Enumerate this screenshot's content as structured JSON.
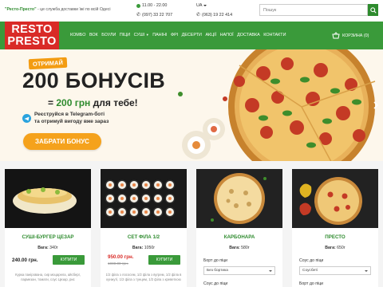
{
  "topbar": {
    "slogan_brand": "\"Ресто-Престо\"",
    "slogan_rest": " - це служба доставки їжі по всій Одесі",
    "hours": "11.00 - 22.00",
    "phone1": "(097) 33 22 707",
    "lang": "UA",
    "phone2": "(063) 19 22 414",
    "search_placeholder": "Пошук"
  },
  "logo": {
    "line1": "RESTO",
    "line2": "PRESTO"
  },
  "nav": {
    "items": [
      "КОМБО",
      "ВОК",
      "БОУЛИ",
      "ПІЦИ",
      "СУШІ",
      "ПАНІНІ",
      "ФРІ",
      "ДЕСЕРТИ",
      "АКЦІЇ",
      "НАПОЇ",
      "ДОСТАВКА",
      "КОНТАКТИ"
    ],
    "cart_label": "КОРЗИНА (0)"
  },
  "banner": {
    "tag": "ОТРИМАЙ",
    "title": "200 БОНУСІВ",
    "subtitle_prefix": "= ",
    "subtitle_highlight": "200 грн",
    "subtitle_suffix": " для тебе!",
    "telegram_line1": "Реєструйся в Telegram-боті",
    "telegram_line2": "та отримуй вигоду вже зараз",
    "button": "ЗАБРАТИ БОНУС"
  },
  "products": [
    {
      "name": "СУШІ-БУРГЕР ЦЕЗАР",
      "weight_label": "Вага:",
      "weight": "340г",
      "price": "240.00 грн.",
      "buy": "КУПИТИ",
      "description": "Курка панірована, сир моцарела, айсберг, пармезан, томати, соус Цезар, рис"
    },
    {
      "name": "СЕТ ФІЛА 1/2",
      "weight_label": "Вага:",
      "weight": "1050г",
      "price": "950.00 грн.",
      "old_price": "1000.00 грн.",
      "buy": "КУПИТИ",
      "description": "1/2 філа з лососем, 1/2 філа з вугрем, 1/2 філа в кунжуті, 1/2 філа з тунцем, 1/2 філа з креветкою"
    },
    {
      "name": "КАРБОНАРА",
      "weight_label": "Вага:",
      "weight": "580г",
      "option_label": "Борт до піци",
      "option_value": "Без бортика",
      "option2_label": "Соус до піци"
    },
    {
      "name": "ПРЕСТО",
      "weight_label": "Вага:",
      "weight": "650г",
      "option_label": "Соус до піци",
      "option_value": "Соусбеті",
      "option2_label": "Борт до піци"
    }
  ],
  "colors": {
    "green": "#3a9a3a",
    "red": "#d92b27",
    "orange": "#f5a21c"
  }
}
